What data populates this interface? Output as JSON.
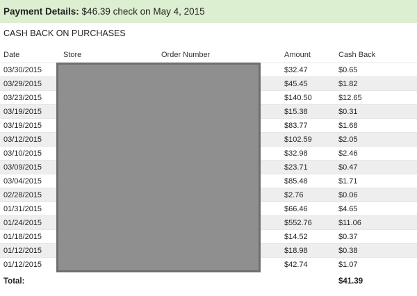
{
  "payment": {
    "label": "Payment Details:",
    "text": " $46.39 check on May 4, 2015"
  },
  "section_title": "CASH BACK ON PURCHASES",
  "columns": {
    "date": "Date",
    "store": "Store",
    "order_number": "Order Number",
    "amount": "Amount",
    "cash_back": "Cash Back"
  },
  "rows": [
    {
      "date": "03/30/2015",
      "amount": "$32.47",
      "cash_back": "$0.65"
    },
    {
      "date": "03/29/2015",
      "amount": "$45.45",
      "cash_back": "$1.82"
    },
    {
      "date": "03/23/2015",
      "amount": "$140.50",
      "cash_back": "$12.65"
    },
    {
      "date": "03/19/2015",
      "amount": "$15.38",
      "cash_back": "$0.31"
    },
    {
      "date": "03/19/2015",
      "amount": "$83.77",
      "cash_back": "$1.68"
    },
    {
      "date": "03/12/2015",
      "amount": "$102.59",
      "cash_back": "$2.05"
    },
    {
      "date": "03/10/2015",
      "amount": "$32.98",
      "cash_back": "$2.46"
    },
    {
      "date": "03/09/2015",
      "amount": "$23.71",
      "cash_back": "$0.47"
    },
    {
      "date": "03/04/2015",
      "amount": "$85.48",
      "cash_back": "$1.71"
    },
    {
      "date": "02/28/2015",
      "amount": "$2.76",
      "cash_back": "$0.06"
    },
    {
      "date": "01/31/2015",
      "amount": "$66.46",
      "cash_back": "$4.65"
    },
    {
      "date": "01/24/2015",
      "amount": "$552.76",
      "cash_back": "$11.06"
    },
    {
      "date": "01/18/2015",
      "amount": "$14.52",
      "cash_back": "$0.37"
    },
    {
      "date": "01/12/2015",
      "amount": "$18.98",
      "cash_back": "$0.38"
    },
    {
      "date": "01/12/2015",
      "amount": "$42.74",
      "cash_back": "$1.07"
    }
  ],
  "total": {
    "label": "Total:",
    "value": "$41.39"
  },
  "colors": {
    "header_bg": "#dcefd1",
    "row_alt_bg": "#eeeeee",
    "redaction": "#8f8f8f"
  }
}
